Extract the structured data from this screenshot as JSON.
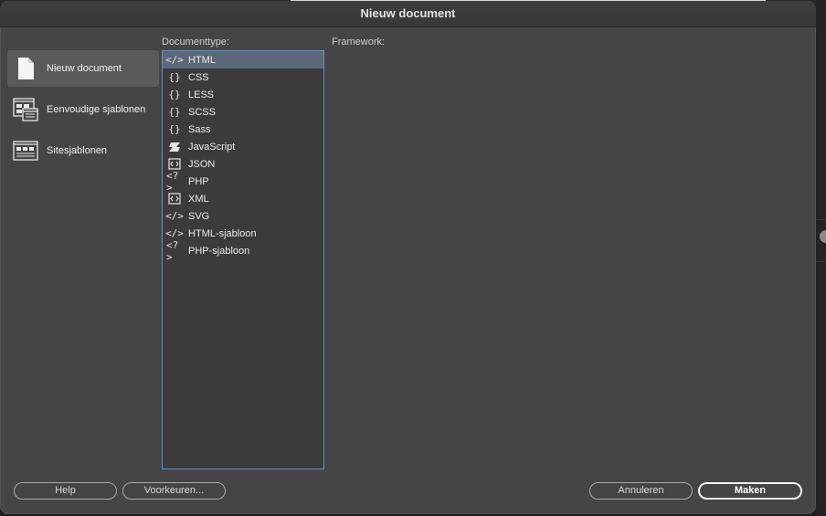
{
  "dialog": {
    "title": "Nieuw document"
  },
  "sidebar": {
    "items": [
      {
        "label": "Nieuw document",
        "icon": "blank-document-icon",
        "selected": true
      },
      {
        "label": "Eenvoudige sjablonen",
        "icon": "starter-templates-icon",
        "selected": false
      },
      {
        "label": "Sitesjablonen",
        "icon": "site-templates-icon",
        "selected": false
      }
    ]
  },
  "main": {
    "documenttype_label": "Documenttype:",
    "framework_label": "Framework:",
    "document_types": [
      {
        "label": "HTML",
        "glyph": "</>",
        "icon": "code-tag-icon"
      },
      {
        "label": "CSS",
        "glyph": "{}",
        "icon": "braces-icon"
      },
      {
        "label": "LESS",
        "glyph": "{}",
        "icon": "braces-icon"
      },
      {
        "label": "SCSS",
        "glyph": "{}",
        "icon": "braces-icon"
      },
      {
        "label": "Sass",
        "glyph": "{}",
        "icon": "braces-icon"
      },
      {
        "label": "JavaScript",
        "glyph": "JS",
        "icon": "javascript-icon"
      },
      {
        "label": "JSON",
        "glyph": "<>",
        "icon": "json-icon"
      },
      {
        "label": "PHP",
        "glyph": "<?>",
        "icon": "php-icon"
      },
      {
        "label": "XML",
        "glyph": "<>",
        "icon": "xml-icon"
      },
      {
        "label": "SVG",
        "glyph": "</>",
        "icon": "code-tag-icon"
      },
      {
        "label": "HTML-sjabloon",
        "glyph": "</>",
        "icon": "code-tag-icon"
      },
      {
        "label": "PHP-sjabloon",
        "glyph": "<?>",
        "icon": "php-icon"
      }
    ],
    "selected_type": "HTML"
  },
  "buttons": {
    "help": "Help",
    "preferences": "Voorkeuren...",
    "cancel": "Annuleren",
    "create": "Maken"
  },
  "colors": {
    "dialog_bg": "#454545",
    "selection": "#5b6878",
    "list_border": "#6a8fb8"
  }
}
